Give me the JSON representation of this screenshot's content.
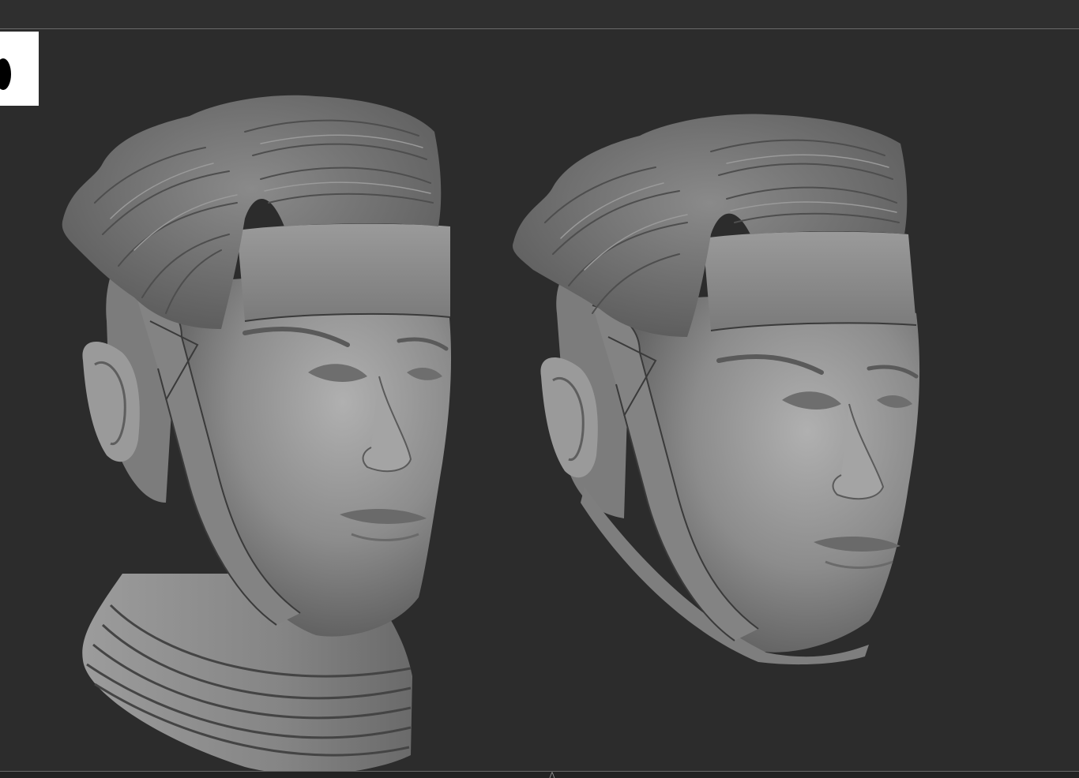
{
  "app": {
    "title": "",
    "bottom_handle_glyph": "⋀"
  },
  "viewport": {
    "background": "#2c2c2c",
    "subjects": [
      {
        "name": "head-sculpt-with-neck",
        "material": "#8a8a8a"
      },
      {
        "name": "head-sculpt-without-neck",
        "material": "#8a8a8a"
      }
    ]
  },
  "colors": {
    "background": "#2d2d2d",
    "divider": "#6a6a6a",
    "clay": "#8a8a8a",
    "clay_dark": "#5a5a5a",
    "clay_light": "#b4b4b4"
  }
}
